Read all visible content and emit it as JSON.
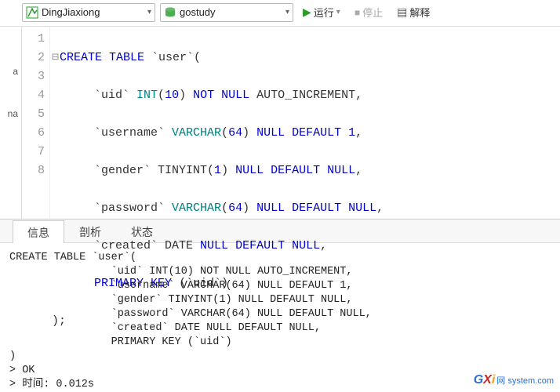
{
  "toolbar": {
    "connection": {
      "label": "DingJiaxiong"
    },
    "database": {
      "label": "gostudy"
    },
    "run": "运行",
    "stop": "停止",
    "explain": "解释"
  },
  "sidetabs": {
    "a": "a",
    "b": "na"
  },
  "gutter": [
    "1",
    "2",
    "3",
    "4",
    "5",
    "6",
    "7",
    "8"
  ],
  "editor": {
    "l1a": "CREATE",
    "l1b": " TABLE",
    "l1c": " `user`(",
    "l2a": "      `uid` ",
    "l2b": "INT",
    "l2c": "(",
    "l2d": "10",
    "l2e": ") ",
    "l2f": "NOT",
    "l2g": " ",
    "l2h": "NULL",
    "l2i": " AUTO_INCREMENT,",
    "l3a": "      `username` ",
    "l3b": "VARCHAR",
    "l3c": "(",
    "l3d": "64",
    "l3e": ") ",
    "l3f": "NULL",
    "l3g": " ",
    "l3h": "DEFAULT",
    "l3i": " ",
    "l3j": "1",
    "l3k": ",",
    "l4a": "      `gender` TINYINT(",
    "l4b": "1",
    "l4c": ") ",
    "l4d": "NULL",
    "l4e": " ",
    "l4f": "DEFAULT",
    "l4g": " ",
    "l4h": "NULL",
    "l4i": ",",
    "l5a": "      `password` ",
    "l5b": "VARCHAR",
    "l5c": "(",
    "l5d": "64",
    "l5e": ") ",
    "l5f": "NULL",
    "l5g": " ",
    "l5h": "DEFAULT",
    "l5i": " ",
    "l5j": "NULL",
    "l5k": ",",
    "l6a": "      `created` DATE ",
    "l6b": "NULL",
    "l6c": " ",
    "l6d": "DEFAULT",
    "l6e": " ",
    "l6f": "NULL",
    "l6g": ",",
    "l7a": "      ",
    "l7b": "PRIMARY",
    "l7c": " ",
    "l7d": "KEY",
    "l7e": " (`uid`)",
    "l8": ");"
  },
  "tabs": {
    "info": "信息",
    "profile": "剖析",
    "status": "状态"
  },
  "output": "CREATE TABLE `user`(\n                `uid` INT(10) NOT NULL AUTO_INCREMENT,\n                `username` VARCHAR(64) NULL DEFAULT 1,\n                `gender` TINYINT(1) NULL DEFAULT NULL,\n                `password` VARCHAR(64) NULL DEFAULT NULL,\n                `created` DATE NULL DEFAULT NULL,\n                PRIMARY KEY (`uid`)\n)\n> OK\n> 时间: 0.012s",
  "watermark": {
    "g": "G",
    "x": "X",
    "i": "i",
    "net": "网\nsystem.com"
  }
}
